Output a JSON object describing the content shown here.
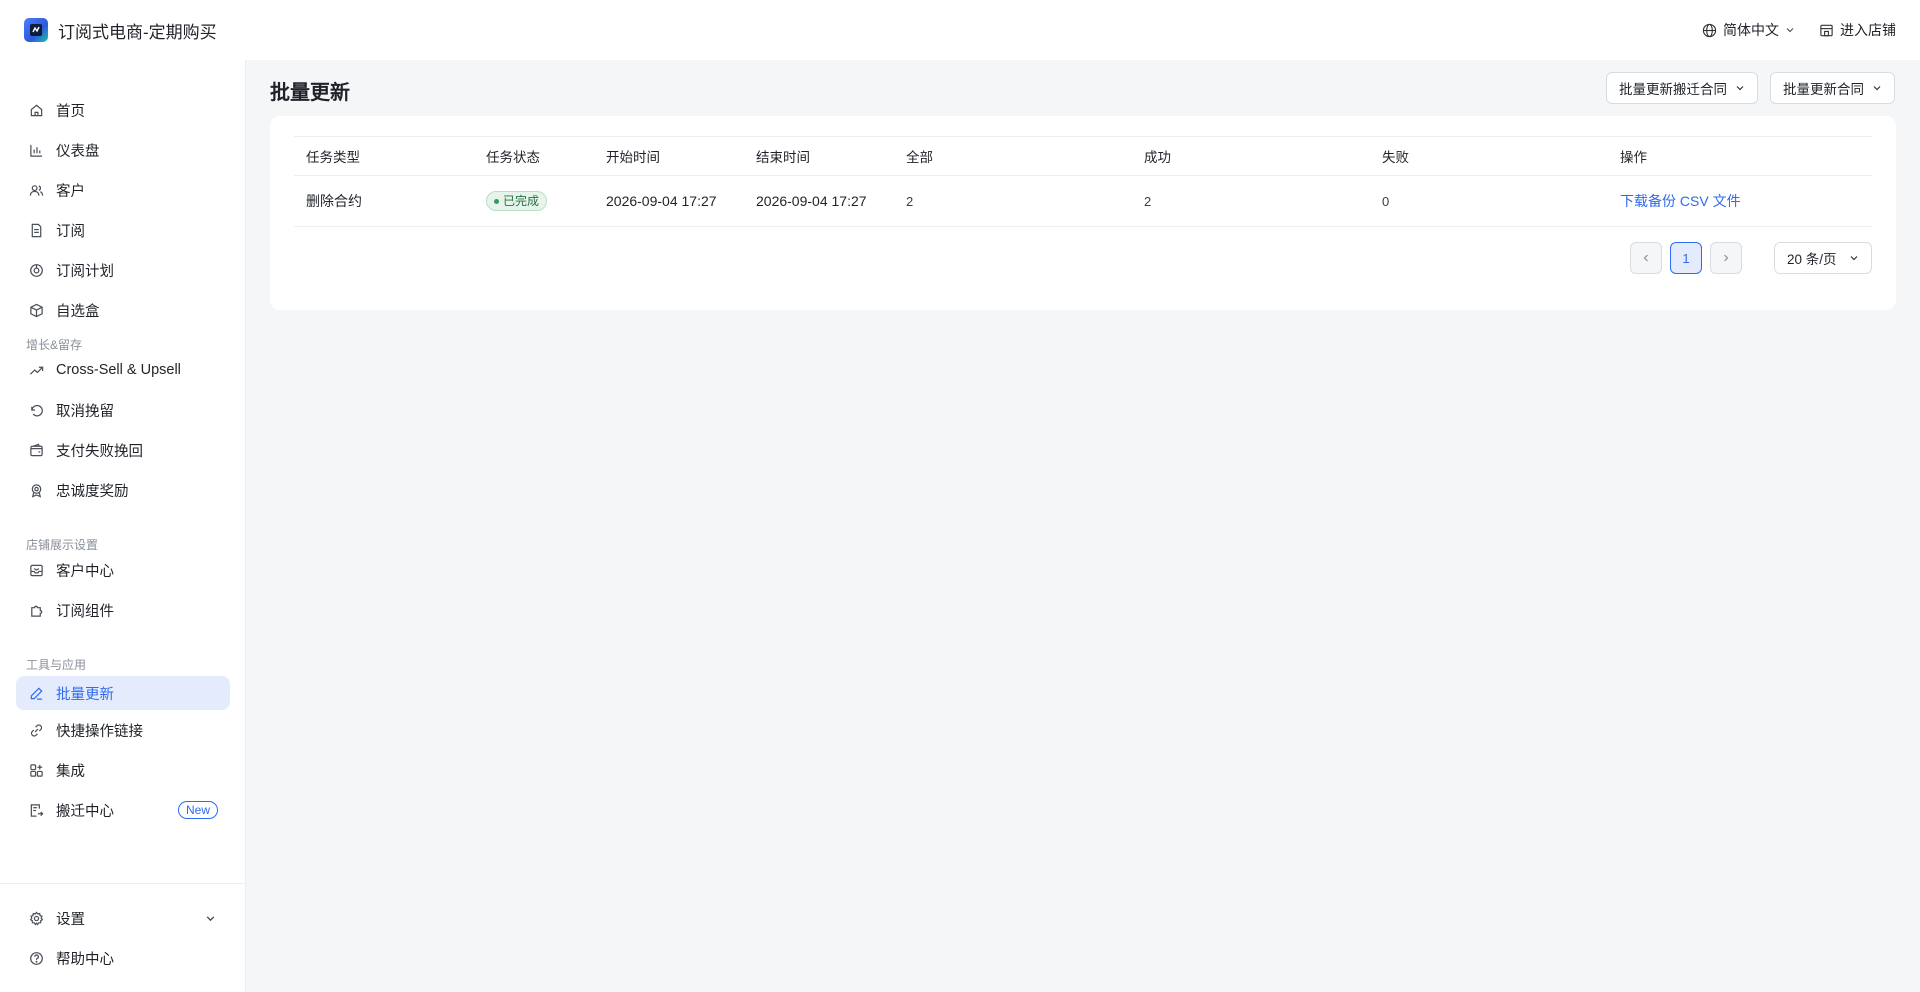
{
  "app": {
    "title": "订阅式电商-定期购买"
  },
  "topbar": {
    "language": "简体中文",
    "enter_store": "进入店铺"
  },
  "sidebar": {
    "items": [
      {
        "label": "首页",
        "icon": "home-icon"
      },
      {
        "label": "仪表盘",
        "icon": "bar-chart-icon"
      },
      {
        "label": "客户",
        "icon": "users-icon"
      },
      {
        "label": "订阅",
        "icon": "document-icon"
      },
      {
        "label": "订阅计划",
        "icon": "plan-icon"
      },
      {
        "label": "自选盒",
        "icon": "box-icon"
      }
    ],
    "section_growth": "增长&留存",
    "growth_items": [
      {
        "label": "Cross-Sell & Upsell",
        "icon": "trend-up-icon"
      },
      {
        "label": "取消挽留",
        "icon": "undo-icon"
      },
      {
        "label": "支付失败挽回",
        "icon": "wallet-icon"
      },
      {
        "label": "忠诚度奖励",
        "icon": "badge-icon"
      }
    ],
    "section_store": "店铺展示设置",
    "store_items": [
      {
        "label": "客户中心",
        "icon": "inbox-icon"
      },
      {
        "label": "订阅组件",
        "icon": "puzzle-icon"
      }
    ],
    "section_tools": "工具与应用",
    "tool_items": [
      {
        "label": "批量更新",
        "icon": "edit-icon",
        "active": true
      },
      {
        "label": "快捷操作链接",
        "icon": "link-icon"
      },
      {
        "label": "集成",
        "icon": "grid-plus-icon"
      },
      {
        "label": "搬迁中心",
        "icon": "migrate-icon",
        "badge": "New"
      }
    ],
    "settings": "设置",
    "help": "帮助中心"
  },
  "main": {
    "title": "批量更新",
    "btn_migrate_contract": "批量更新搬迁合同",
    "btn_update_contract": "批量更新合同",
    "table": {
      "headers": [
        "任务类型",
        "任务状态",
        "开始时间",
        "结束时间",
        "全部",
        "成功",
        "失败",
        "操作"
      ],
      "rows": [
        {
          "type": "删除合约",
          "status": "已完成",
          "start": "2026-09-04 17:27",
          "end": "2026-09-04 17:27",
          "total": "2",
          "success": "2",
          "failed": "0",
          "action": "下载备份 CSV 文件"
        }
      ]
    },
    "pagination": {
      "current_page": "1",
      "page_size": "20 条/页"
    }
  },
  "colors": {
    "accent": "#2f6bef",
    "active_bg": "#e3ebfd",
    "success": "#2f9e5a"
  }
}
